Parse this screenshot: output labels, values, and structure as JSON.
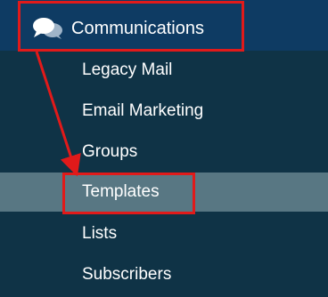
{
  "nav": {
    "section": {
      "label": "Communications",
      "icon": "chat-bubbles-icon"
    },
    "items": [
      {
        "label": "Legacy Mail"
      },
      {
        "label": "Email Marketing"
      },
      {
        "label": "Groups"
      },
      {
        "label": "Templates",
        "active": true
      },
      {
        "label": "Lists"
      },
      {
        "label": "Subscribers"
      }
    ]
  },
  "colors": {
    "header_bg": "#0e3b63",
    "nav_bg": "#0f3346",
    "active_bg": "#587783",
    "annotation": "#e11a1a",
    "text": "#ffffff"
  }
}
